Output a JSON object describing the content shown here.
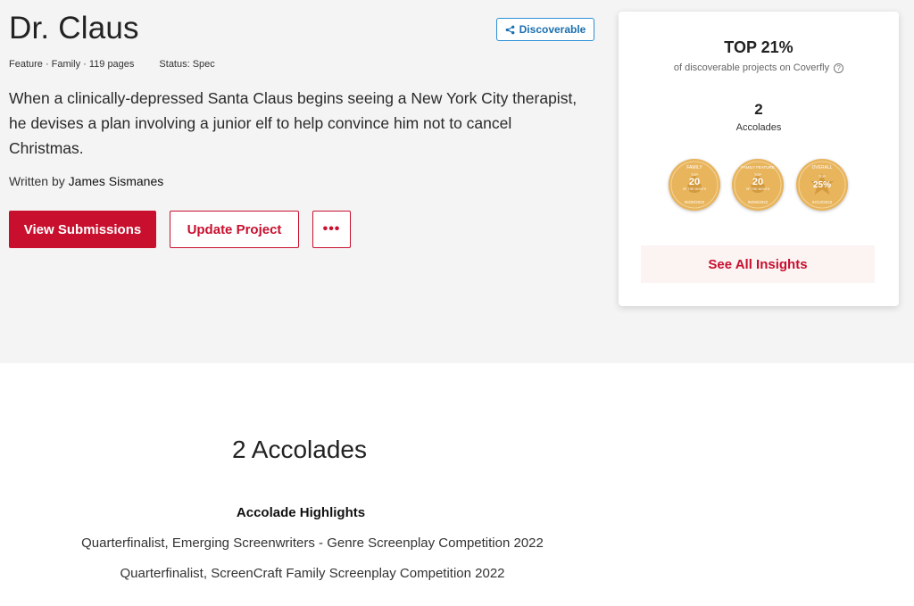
{
  "project": {
    "title": "Dr. Claus",
    "discoverable_label": "Discoverable",
    "meta": "Feature · Family · 119 pages",
    "status": "Status: Spec",
    "logline": "When a clinically-depressed Santa Claus begins seeing a New York City therapist, he devises a plan involving a junior elf to help convince him not to cancel Christmas.",
    "written_by_prefix": "Written by",
    "writer": "James Sismanes"
  },
  "actions": {
    "view_submissions": "View Submissions",
    "update_project": "Update Project",
    "more": "•••"
  },
  "insights_card": {
    "rank": "TOP 21%",
    "rank_sub": "of discoverable projects on Coverfly",
    "help_glyph": "?",
    "accolade_count": "2",
    "accolade_label": "Accolades",
    "see_all": "See All Insights",
    "badges": [
      {
        "arc": "FAMILY",
        "top": "TOP",
        "value": "20",
        "sub": "OF THE MONTH",
        "date": "05/30/2022"
      },
      {
        "arc": "FAMILY FEATURE",
        "top": "TOP",
        "value": "20",
        "sub": "OF THE MONTH",
        "date": "06/06/2022"
      },
      {
        "arc": "OVERALL",
        "top": "TOP",
        "value": "25%",
        "sub": "",
        "date": "04/13/2022"
      }
    ]
  },
  "accolades": {
    "title": "2 Accolades",
    "highlights_title": "Accolade Highlights",
    "items": [
      "Quarterfinalist, Emerging Screenwriters - Genre Screenplay Competition 2022",
      "Quarterfinalist, ScreenCraft Family Screenplay Competition 2022"
    ]
  },
  "colors": {
    "brand_red": "#c8102e",
    "badge_gold": "#e8b45c",
    "link_blue": "#1a6fb0"
  }
}
